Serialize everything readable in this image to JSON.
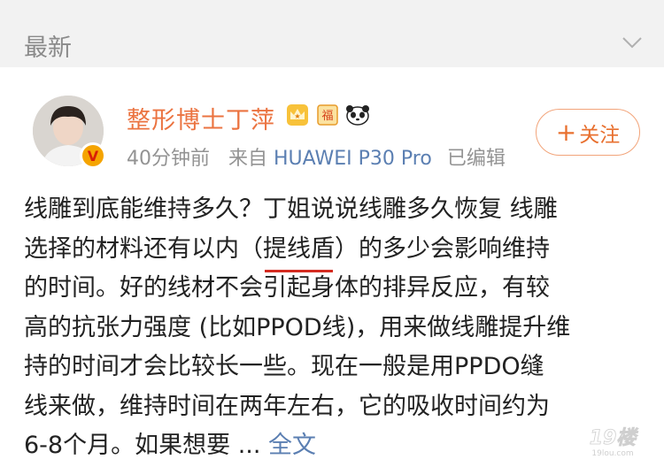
{
  "feed": {
    "section_label": "最新"
  },
  "post": {
    "author": {
      "name": "整形博士丁萍",
      "badges": [
        "crown-badge",
        "fu-badge",
        "panda-badge"
      ],
      "verified": true
    },
    "time": "40分钟前",
    "source_prefix": "来自",
    "device": "HUAWEI P30 Pro",
    "edited": "已编辑",
    "follow_label": "关注",
    "text_lines": [
      "线雕到底能维持多久？丁姐说说线雕多久恢复 线雕",
      "选择的材料还有以内",
      "提线盾",
      "的多少会影响维持",
      "的时间。好的线材不会引起身体的排异反应，有较",
      "高的抗张力强度 (比如PPOD线)，用来做线雕提升维",
      "持的时间才会比较长一些。现在一般是用PPDO缝",
      "线来做，维持时间在两年左右，它的吸收时间约为",
      "6-8个月。如果想要"
    ],
    "ellipsis": "...",
    "expand_label": "全文"
  },
  "watermark": {
    "text": "19楼",
    "subtext": "19lou.com"
  },
  "colors": {
    "accent": "#eb7340",
    "link": "#5b7fb2",
    "underline": "#d42b20",
    "header_bg": "#f2f2f2"
  }
}
